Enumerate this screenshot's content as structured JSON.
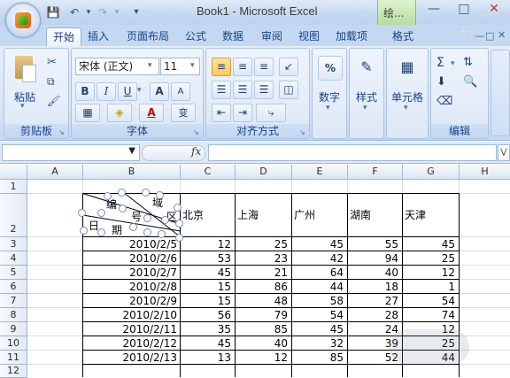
{
  "app": {
    "window_title": "Book1 - Microsoft Excel",
    "contextual_tab": "绘...",
    "quick_access": [
      "save-icon",
      "undo-icon",
      "redo-icon",
      "customize-qat-icon"
    ],
    "window_controls": [
      "minimize-icon",
      "maximize-icon",
      "close-icon"
    ]
  },
  "ribbon": {
    "tabs": [
      "开始",
      "插入",
      "页面布局",
      "公式",
      "数据",
      "审阅",
      "视图",
      "加载项",
      "格式"
    ],
    "active_tab": "开始",
    "clipboard": {
      "label": "剪贴板",
      "paste_label": "粘贴"
    },
    "font": {
      "label": "字体",
      "font_name": "宋体 (正文)",
      "font_size": "11",
      "bold": "B",
      "italic": "I",
      "underline": "U",
      "grow": "A",
      "shrink": "A",
      "phonetic": "变"
    },
    "alignment": {
      "label": "对齐方式"
    },
    "number": {
      "label": "数字",
      "icon_text": "%"
    },
    "styles": {
      "label": "样式"
    },
    "cells": {
      "label": "单元格"
    },
    "editing": {
      "label": "编辑",
      "sum_symbol": "Σ"
    }
  },
  "formula_bar": {
    "name_box": "",
    "fx_label": "fx",
    "content": ""
  },
  "sheet": {
    "columns": [
      "A",
      "B",
      "C",
      "D",
      "E",
      "F",
      "G",
      "H"
    ],
    "rows": [
      "1",
      "2",
      "3",
      "4",
      "5",
      "6",
      "7",
      "8",
      "9",
      "10",
      "11",
      "12"
    ],
    "header_cell_text": {
      "bian": "编",
      "hao": "号",
      "qu": "区",
      "yu": "域",
      "ri": "日",
      "qi": "期"
    },
    "city_headers": [
      "北京",
      "上海",
      "广州",
      "湖南",
      "天津"
    ],
    "data_rows": [
      {
        "date": "2010/2/5",
        "values": [
          "12",
          "25",
          "45",
          "55",
          "45"
        ]
      },
      {
        "date": "2010/2/6",
        "values": [
          "53",
          "23",
          "42",
          "94",
          "25"
        ]
      },
      {
        "date": "2010/2/7",
        "values": [
          "45",
          "21",
          "64",
          "40",
          "12"
        ]
      },
      {
        "date": "2010/2/8",
        "values": [
          "15",
          "86",
          "44",
          "18",
          "1"
        ]
      },
      {
        "date": "2010/2/9",
        "values": [
          "15",
          "48",
          "58",
          "27",
          "54"
        ]
      },
      {
        "date": "2010/2/10",
        "values": [
          "56",
          "79",
          "54",
          "28",
          "74"
        ]
      },
      {
        "date": "2010/2/11",
        "values": [
          "35",
          "85",
          "45",
          "24",
          "12"
        ]
      },
      {
        "date": "2010/2/12",
        "values": [
          "45",
          "40",
          "32",
          "39",
          "25"
        ]
      },
      {
        "date": "2010/2/13",
        "values": [
          "13",
          "12",
          "85",
          "52",
          "44"
        ]
      }
    ]
  }
}
